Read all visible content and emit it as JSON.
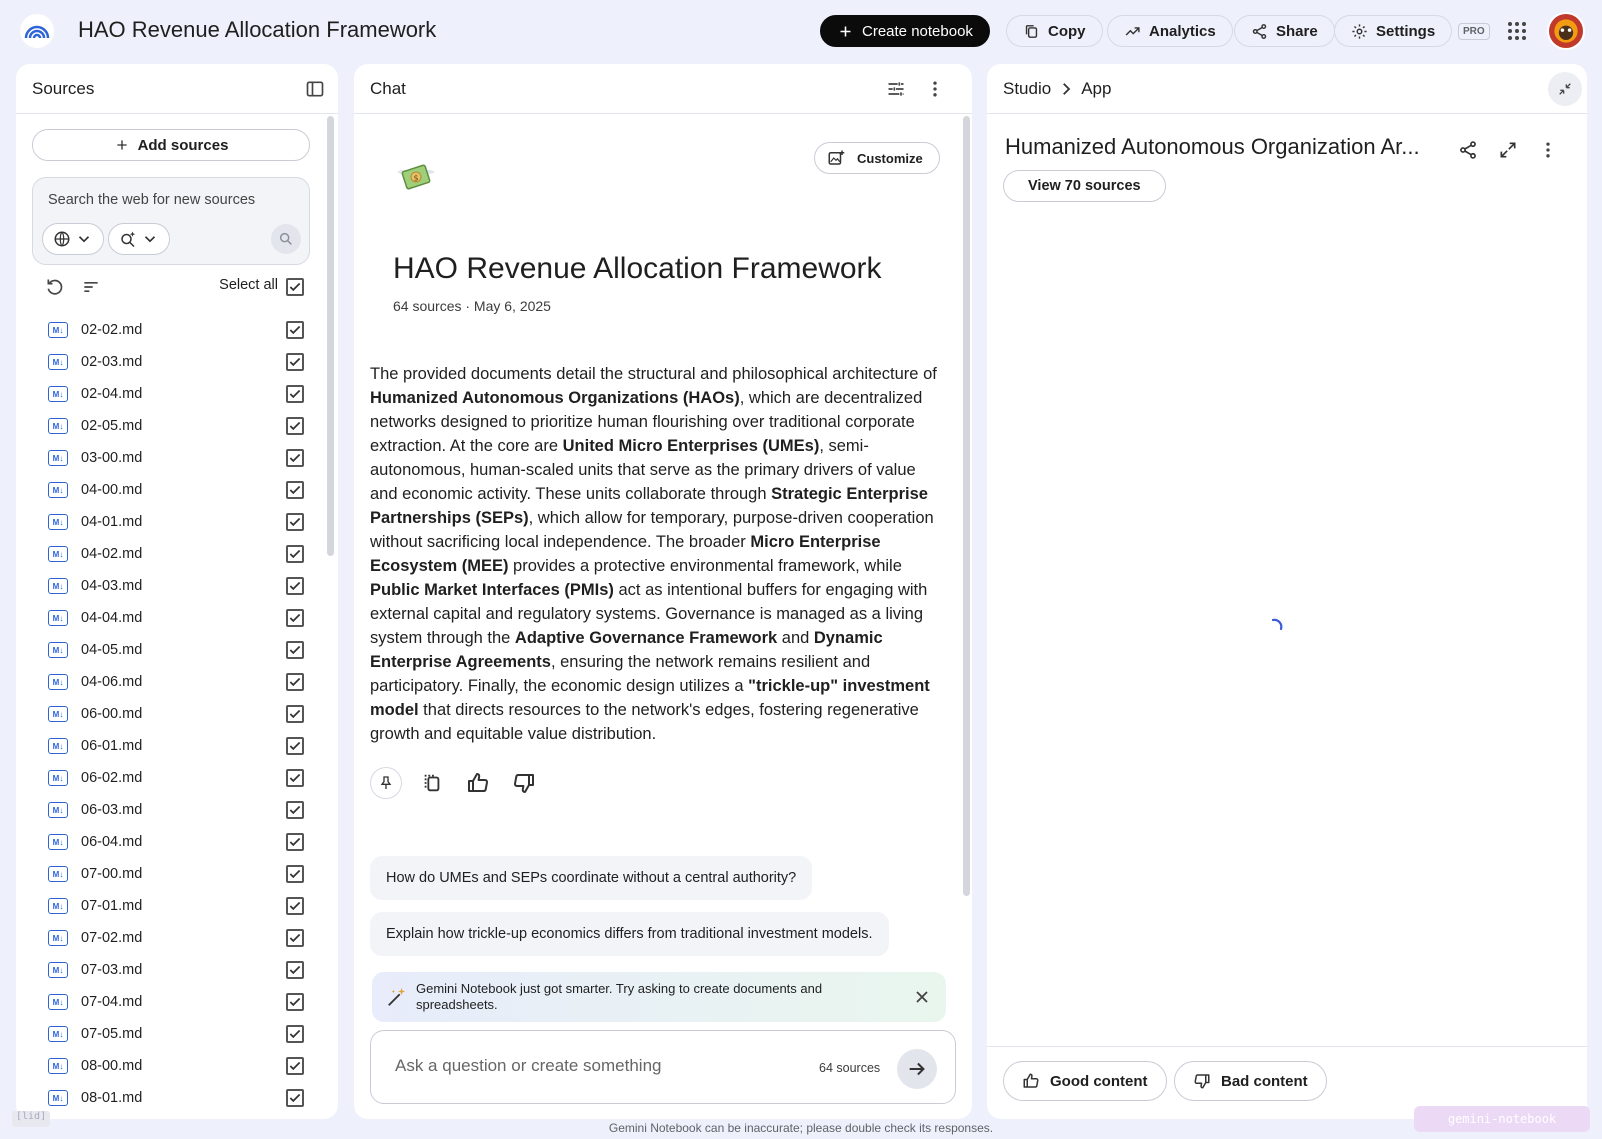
{
  "header": {
    "title": "HAO Revenue Allocation Framework",
    "create_notebook": "Create notebook",
    "copy": "Copy",
    "analytics": "Analytics",
    "share": "Share",
    "settings": "Settings",
    "pro_badge": "PRO"
  },
  "sources_panel": {
    "title": "Sources",
    "add_sources": "Add sources",
    "search_placeholder": "Search the web for new sources",
    "select_all": "Select all",
    "items": [
      "02-02.md",
      "02-03.md",
      "02-04.md",
      "02-05.md",
      "03-00.md",
      "04-00.md",
      "04-01.md",
      "04-02.md",
      "04-03.md",
      "04-04.md",
      "04-05.md",
      "04-06.md",
      "06-00.md",
      "06-01.md",
      "06-02.md",
      "06-03.md",
      "06-04.md",
      "07-00.md",
      "07-01.md",
      "07-02.md",
      "07-03.md",
      "07-04.md",
      "07-05.md",
      "08-00.md",
      "08-01.md"
    ]
  },
  "chat_panel": {
    "title": "Chat",
    "customize": "Customize",
    "notebook_title": "HAO Revenue Allocation Framework",
    "meta": "64 sources · May 6, 2025",
    "summary": [
      {
        "t": "The provided documents detail the structural and philosophical architecture of "
      },
      {
        "t": "Humanized Autonomous Organizations (HAOs)",
        "b": true
      },
      {
        "t": ", which are decentralized networks designed to prioritize human flourishing over traditional corporate extraction. At the core are "
      },
      {
        "t": "United Micro Enterprises (UMEs)",
        "b": true
      },
      {
        "t": ", semi-autonomous, human-scaled units that serve as the primary drivers of value and economic activity. These units collaborate through "
      },
      {
        "t": "Strategic Enterprise Partnerships (SEPs)",
        "b": true
      },
      {
        "t": ", which allow for temporary, purpose-driven cooperation without sacrificing local independence. The broader "
      },
      {
        "t": "Micro Enterprise Ecosystem (MEE)",
        "b": true
      },
      {
        "t": " provides a protective environmental framework, while "
      },
      {
        "t": "Public Market Interfaces (PMIs)",
        "b": true
      },
      {
        "t": " act as intentional buffers for engaging with external capital and regulatory systems. Governance is managed as a living system through the "
      },
      {
        "t": "Adaptive Governance Framework",
        "b": true
      },
      {
        "t": " and "
      },
      {
        "t": "Dynamic Enterprise Agreements",
        "b": true
      },
      {
        "t": ", ensuring the network remains resilient and participatory. Finally, the economic design utilizes a "
      },
      {
        "t": "\"trickle-up\" investment model",
        "b": true
      },
      {
        "t": " that directs resources to the network's edges, fostering regenerative growth and equitable value distribution."
      }
    ],
    "suggestions": [
      "How do UMEs and SEPs coordinate without a central authority?",
      "Explain how trickle-up economics differs from traditional investment models."
    ],
    "banner": "Gemini Notebook just got smarter. Try asking to create documents and spreadsheets.",
    "composer_placeholder": "Ask a question or create something",
    "composer_count": "64 sources"
  },
  "studio_panel": {
    "crumb_studio": "Studio",
    "crumb_app": "App",
    "heading": "Humanized Autonomous Organization Ar...",
    "view_sources": "View 70 sources",
    "good_content": "Good content",
    "bad_content": "Bad content"
  },
  "footer": {
    "disclaimer": "Gemini Notebook can be inaccurate; please double check its responses.",
    "corner_tag": "[lid]",
    "brand_tag": "gemini-notebook"
  },
  "colors": {
    "accent_blue": "#2f64d6",
    "page_bg": "#eef0fb",
    "spinner": "#3b5bdb"
  },
  "icons": {
    "logo": "notebook-logo-icon",
    "apps": "apps-grid-icon",
    "md_file": "markdown-file-icon",
    "check": "checkbox-checked-icon"
  }
}
